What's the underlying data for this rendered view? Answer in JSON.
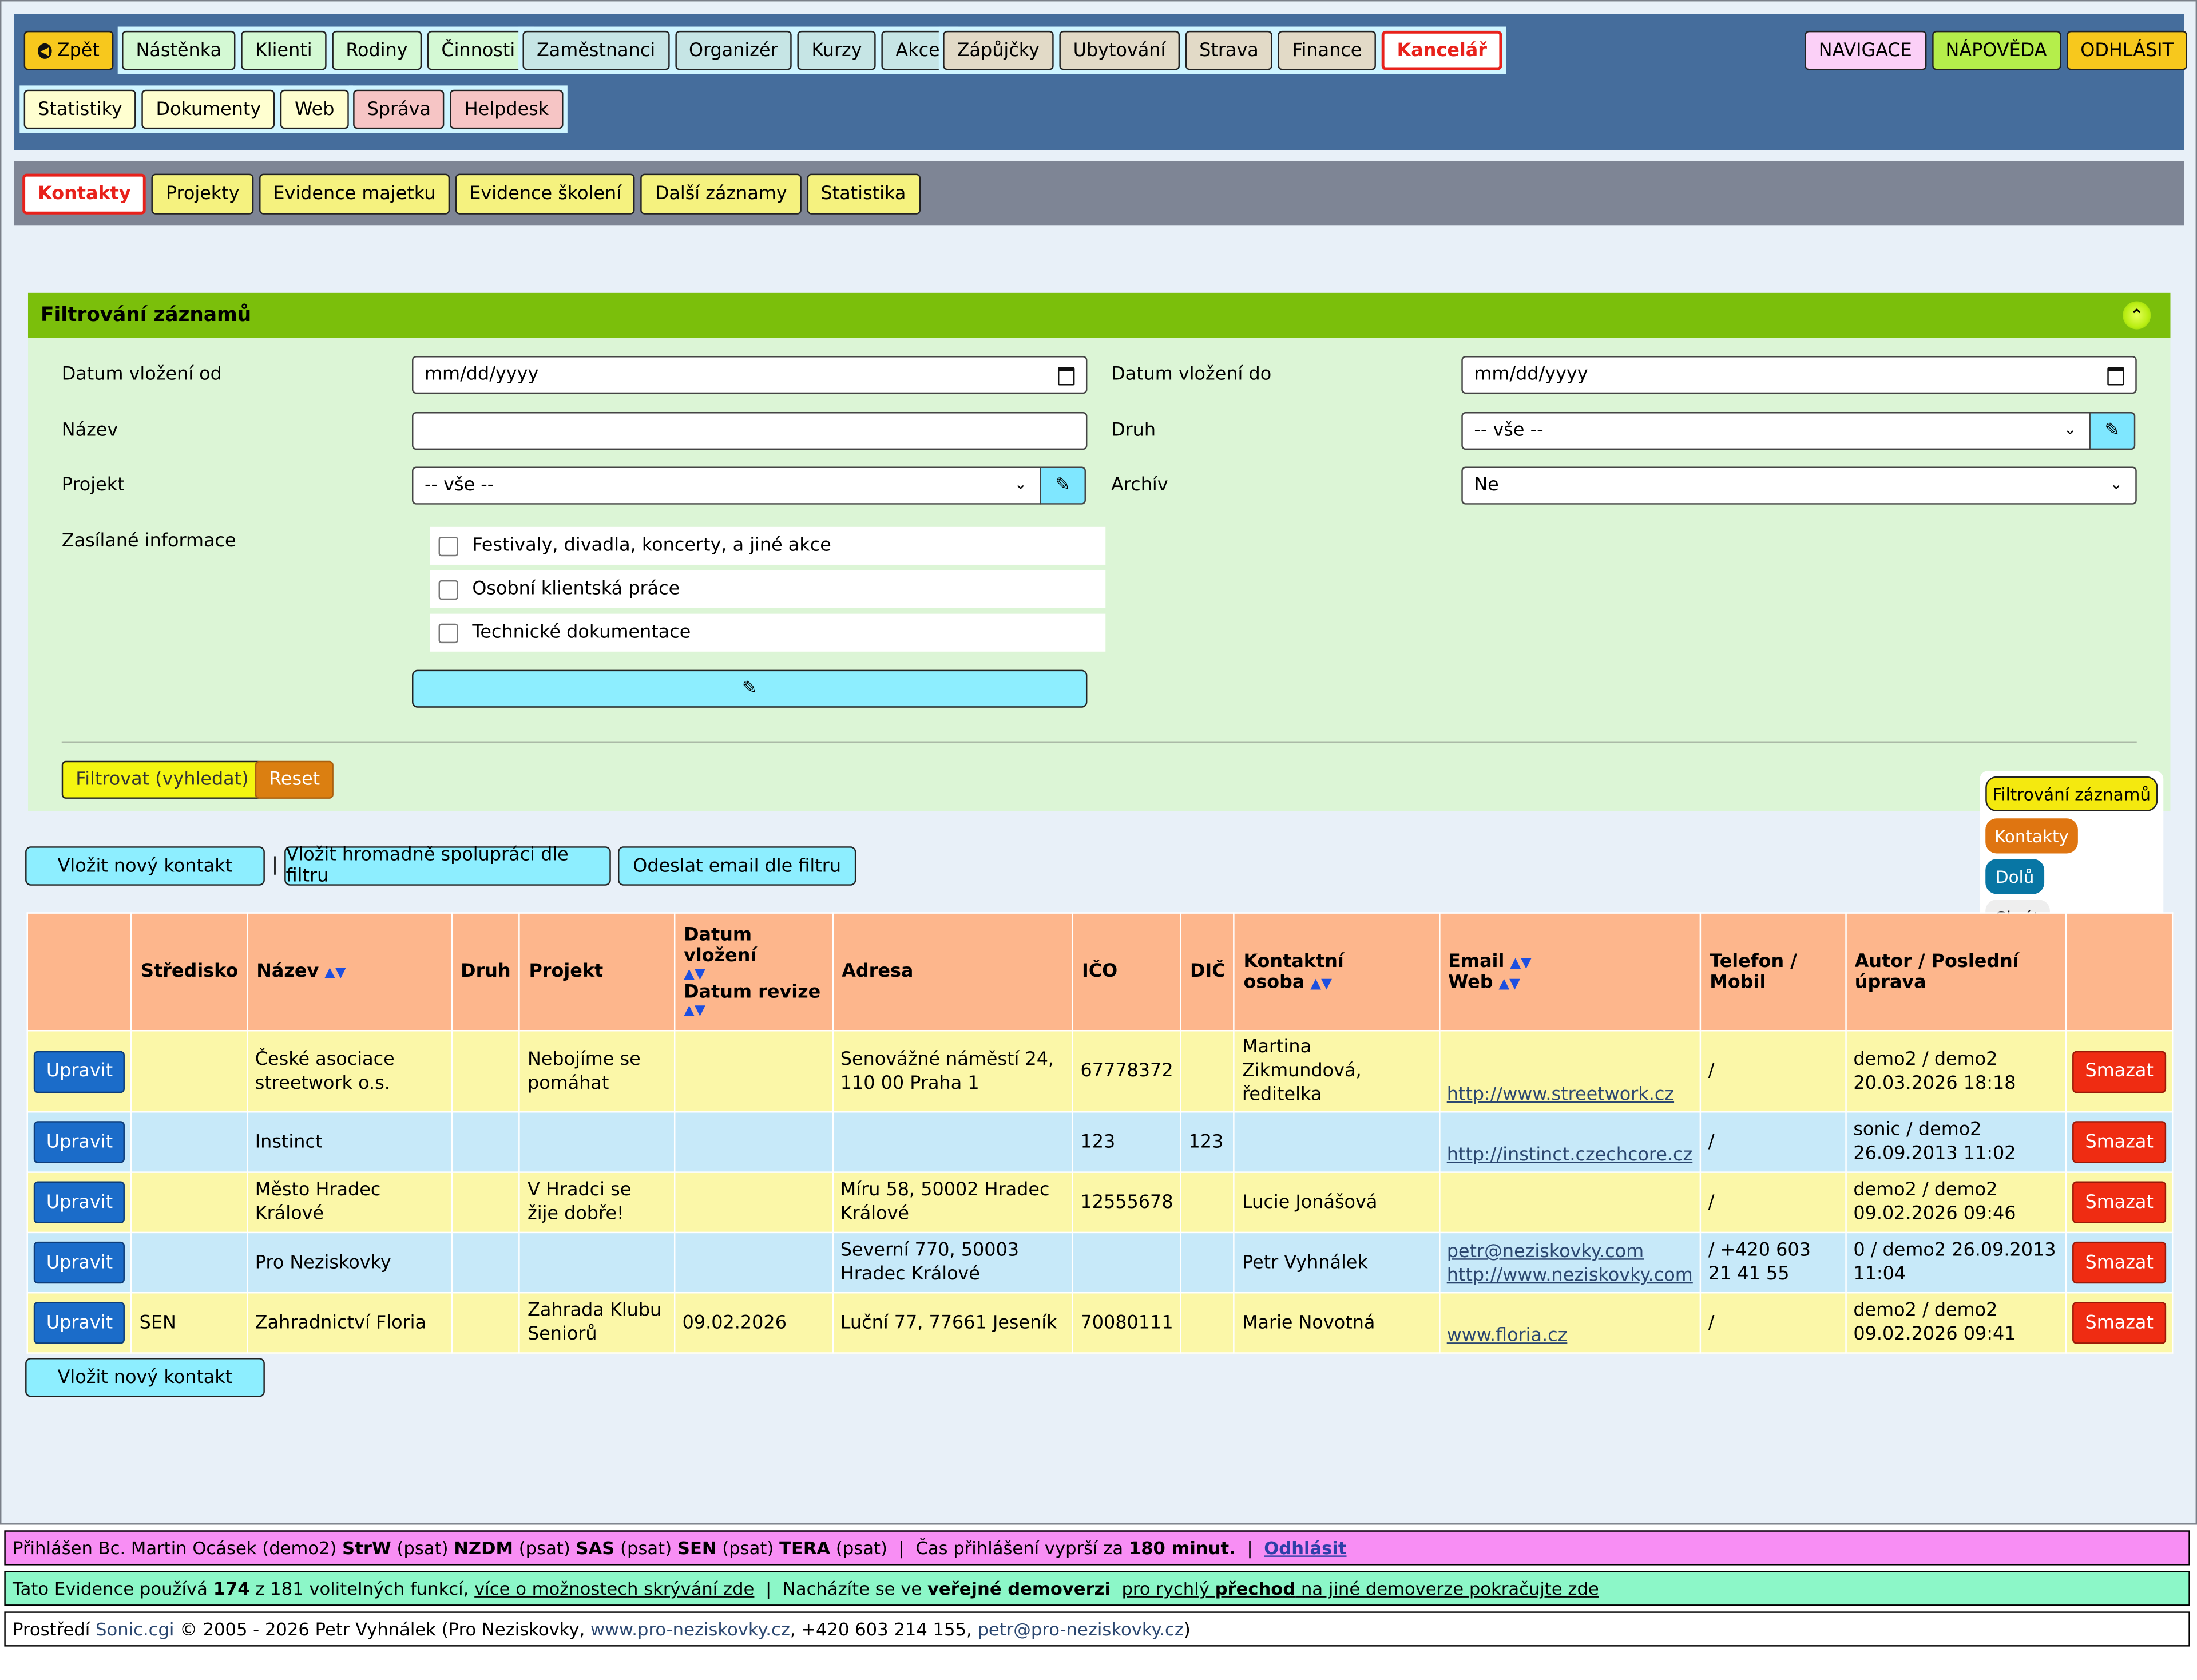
{
  "topnav": {
    "back": "Zpět",
    "group1": [
      "Nástěnka",
      "Klienti",
      "Rodiny",
      "Činnosti"
    ],
    "group2": [
      "Zaměstnanci",
      "Organizér",
      "Kurzy",
      "Akce"
    ],
    "group3": [
      "Zápůjčky",
      "Ubytování",
      "Strava",
      "Finance",
      "Kancelář"
    ],
    "group4": [
      "Statistiky",
      "Dokumenty",
      "Web"
    ],
    "group5": [
      "Správa",
      "Helpdesk"
    ],
    "right": [
      "NAVIGACE",
      "NÁPOVĚDA",
      "ODHLÁSIT"
    ]
  },
  "subnav": [
    "Kontakty",
    "Projekty",
    "Evidence majetku",
    "Evidence školení",
    "Další záznamy",
    "Statistika"
  ],
  "filter": {
    "title": "Filtrování záznamů",
    "date_from_label": "Datum vložení od",
    "date_from_value": "mm/dd/yyyy",
    "date_to_label": "Datum vložení do",
    "date_to_value": "mm/dd/yyyy",
    "name_label": "Název",
    "name_value": "",
    "type_label": "Druh",
    "type_value": "-- vše --",
    "project_label": "Projekt",
    "project_value": "-- vše --",
    "archive_label": "Archív",
    "archive_value": "Ne",
    "info_label": "Zasílané informace",
    "info_options": [
      "Festivaly, divadla, koncerty, a jiné akce",
      "Osobní klientská práce",
      "Technické dokumentace"
    ],
    "submit": "Filtrovat (vyhledat)",
    "reset": "Reset"
  },
  "floating": [
    "Filtrování záznamů",
    "Kontakty",
    "Dolů",
    "Skrýt"
  ],
  "actions": {
    "new_contact": "Vložit nový kontakt",
    "separator": "|",
    "bulk": "Vložit hromadně spolupráci dle filtru",
    "email": "Odeslat email dle filtru"
  },
  "table": {
    "headers": {
      "center": "Středisko",
      "name": "Název",
      "type": "Druh",
      "project": "Projekt",
      "date_in": "Datum vložení",
      "date_rev": "Datum revize",
      "address": "Adresa",
      "ico": "IČO",
      "dic": "DIČ",
      "contact": "Kontaktní osoba",
      "email": "Email",
      "web": "Web",
      "phone": "Telefon /",
      "mobile": "Mobil",
      "author": "Autor / Poslední",
      "modified": "úprava",
      "sort_arrows": "▲▼"
    },
    "edit_label": "Upravit",
    "delete_label": "Smazat",
    "rows": [
      {
        "center": "",
        "name": "České asociace streetwork o.s.",
        "type": "",
        "project": "Nebojíme se pomáhat",
        "date": "",
        "address": "Senovážné náměstí 24, 110 00 Praha 1",
        "ico": "67778372",
        "dic": "",
        "contact": "Martina Zikmundová, ředitelka",
        "email": "",
        "web": "http://www.streetwork.cz",
        "phone": "/",
        "author": "demo2 / demo2 20.03.2026 18:18"
      },
      {
        "center": "",
        "name": "Instinct",
        "type": "",
        "project": "",
        "date": "",
        "address": "",
        "ico": "123",
        "dic": "123",
        "contact": "",
        "email": "",
        "web": "http://instinct.czechcore.cz",
        "phone": "/",
        "author": "sonic / demo2 26.09.2013 11:02"
      },
      {
        "center": "",
        "name": "Město Hradec Králové",
        "type": "",
        "project": "V Hradci se žije dobře!",
        "date": "",
        "address": "Míru 58, 50002 Hradec Králové",
        "ico": "12555678",
        "dic": "",
        "contact": "Lucie Jonášová",
        "email": "",
        "web": "",
        "phone": "/",
        "author": "demo2 / demo2 09.02.2026 09:46"
      },
      {
        "center": "",
        "name": "Pro Neziskovky",
        "type": "",
        "project": "",
        "date": "",
        "address": "Severní 770, 50003 Hradec Králové",
        "ico": "",
        "dic": "",
        "contact": "Petr Vyhnálek",
        "email": "petr@neziskovky.com",
        "web": "http://www.neziskovky.com",
        "phone": "/ +420 603 21 41 55",
        "author": "0 / demo2 26.09.2013 11:04"
      },
      {
        "center": "SEN",
        "name": "Zahradnictví Floria",
        "type": "",
        "project": "Zahrada Klubu Seniorů",
        "date": "09.02.2026",
        "address": "Luční 77, 77661 Jeseník",
        "ico": "70080111",
        "dic": "",
        "contact": "Marie Novotná",
        "email": "",
        "web": "www.floria.cz",
        "phone": "/",
        "author": "demo2 / demo2 09.02.2026 09:41"
      }
    ]
  },
  "footer": {
    "line1": {
      "prefix": "Přihlášen Bc. Martin Ocásek (demo2) ",
      "orgs": [
        [
          "StrW",
          "(psat)"
        ],
        [
          "NZDM",
          "(psat)"
        ],
        [
          "SAS",
          "(psat)"
        ],
        [
          "SEN",
          "(psat)"
        ],
        [
          "TERA",
          "(psat)"
        ]
      ],
      "sep": "|",
      "timeout_text": "Čas přihlášení vyprší za",
      "timeout_value": "180 minut.",
      "logout": "Odhlásit"
    },
    "line2": {
      "t1": "Tato Evidence používá",
      "used": "174",
      "t2": "z 181 volitelných funkcí,",
      "link1": "více o možnostech skrývání zde",
      "sep": "|",
      "t3": "Nacházíte se ve",
      "public": "veřejné demoverzi",
      "link2a": "pro rychlý",
      "link2b": "přechod",
      "link2c": "na jiné demoverze pokračujte zde"
    },
    "line3": {
      "t1": "Prostředí",
      "sonic": "Sonic.cgi",
      "t2": "© 2005 - 2026 Petr Vyhnálek (Pro Neziskovky,",
      "site": "www.pro-neziskovky.cz",
      "t3": ", +420 603 214 155,",
      "mail": "petr@pro-neziskovky.cz",
      "t4": ")"
    }
  },
  "colors": {
    "topnav_bg": "#456d9c",
    "panel_head": "#7bbf0b",
    "panel_bg": "#dcf5d6",
    "table_head": "#fdb68c",
    "row_yellow": "#fbf7a8",
    "row_blue": "#c7e9f9",
    "active_red": "#e8211b"
  }
}
